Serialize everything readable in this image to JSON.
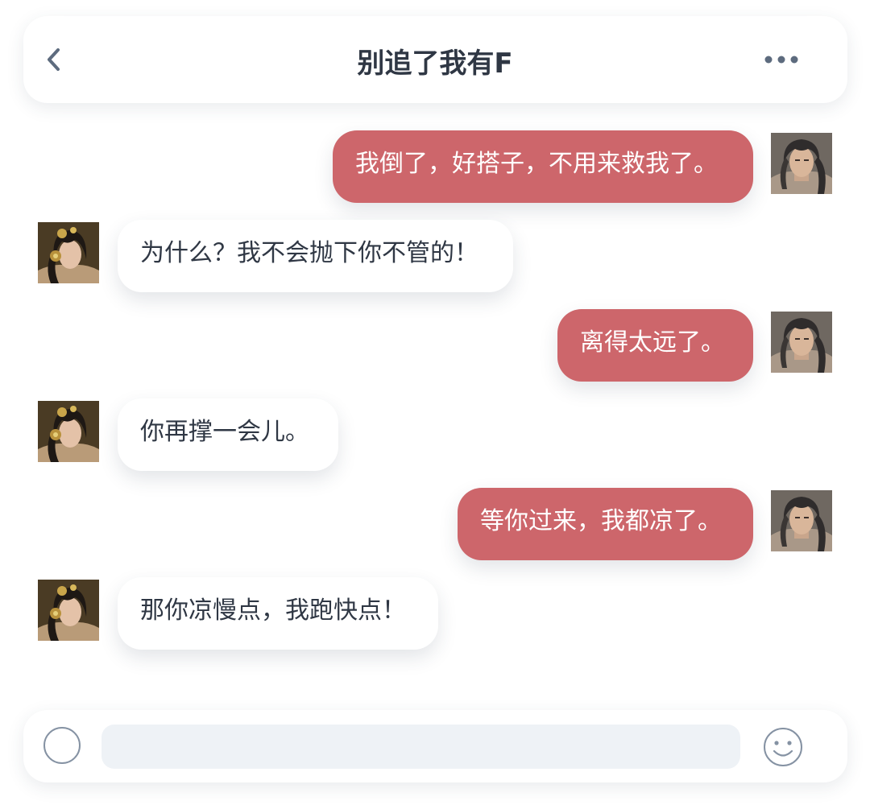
{
  "header": {
    "title": "别追了我有F",
    "back_icon": "chevron-left-icon",
    "more_icon": "more-horizontal-icon"
  },
  "messages": [
    {
      "sender": "me",
      "text": "我倒了，好搭子，不用来救我了。"
    },
    {
      "sender": "her",
      "text": "为什么？我不会抛下你不管的！"
    },
    {
      "sender": "me",
      "text": "离得太远了。"
    },
    {
      "sender": "her",
      "text": "你再撑一会儿。"
    },
    {
      "sender": "me",
      "text": "等你过来，我都凉了。"
    },
    {
      "sender": "her",
      "text": "那你凉慢点，我跑快点！"
    }
  ],
  "composer": {
    "input_value": "",
    "voice_icon": "voice-circle-icon",
    "emoji_icon": "smiley-icon"
  },
  "colors": {
    "my_bubble": "#cd666b",
    "her_bubble": "#ffffff",
    "title_text": "#2f3744",
    "icon": "#5d6b7e",
    "input_bg": "#eef2f6"
  }
}
